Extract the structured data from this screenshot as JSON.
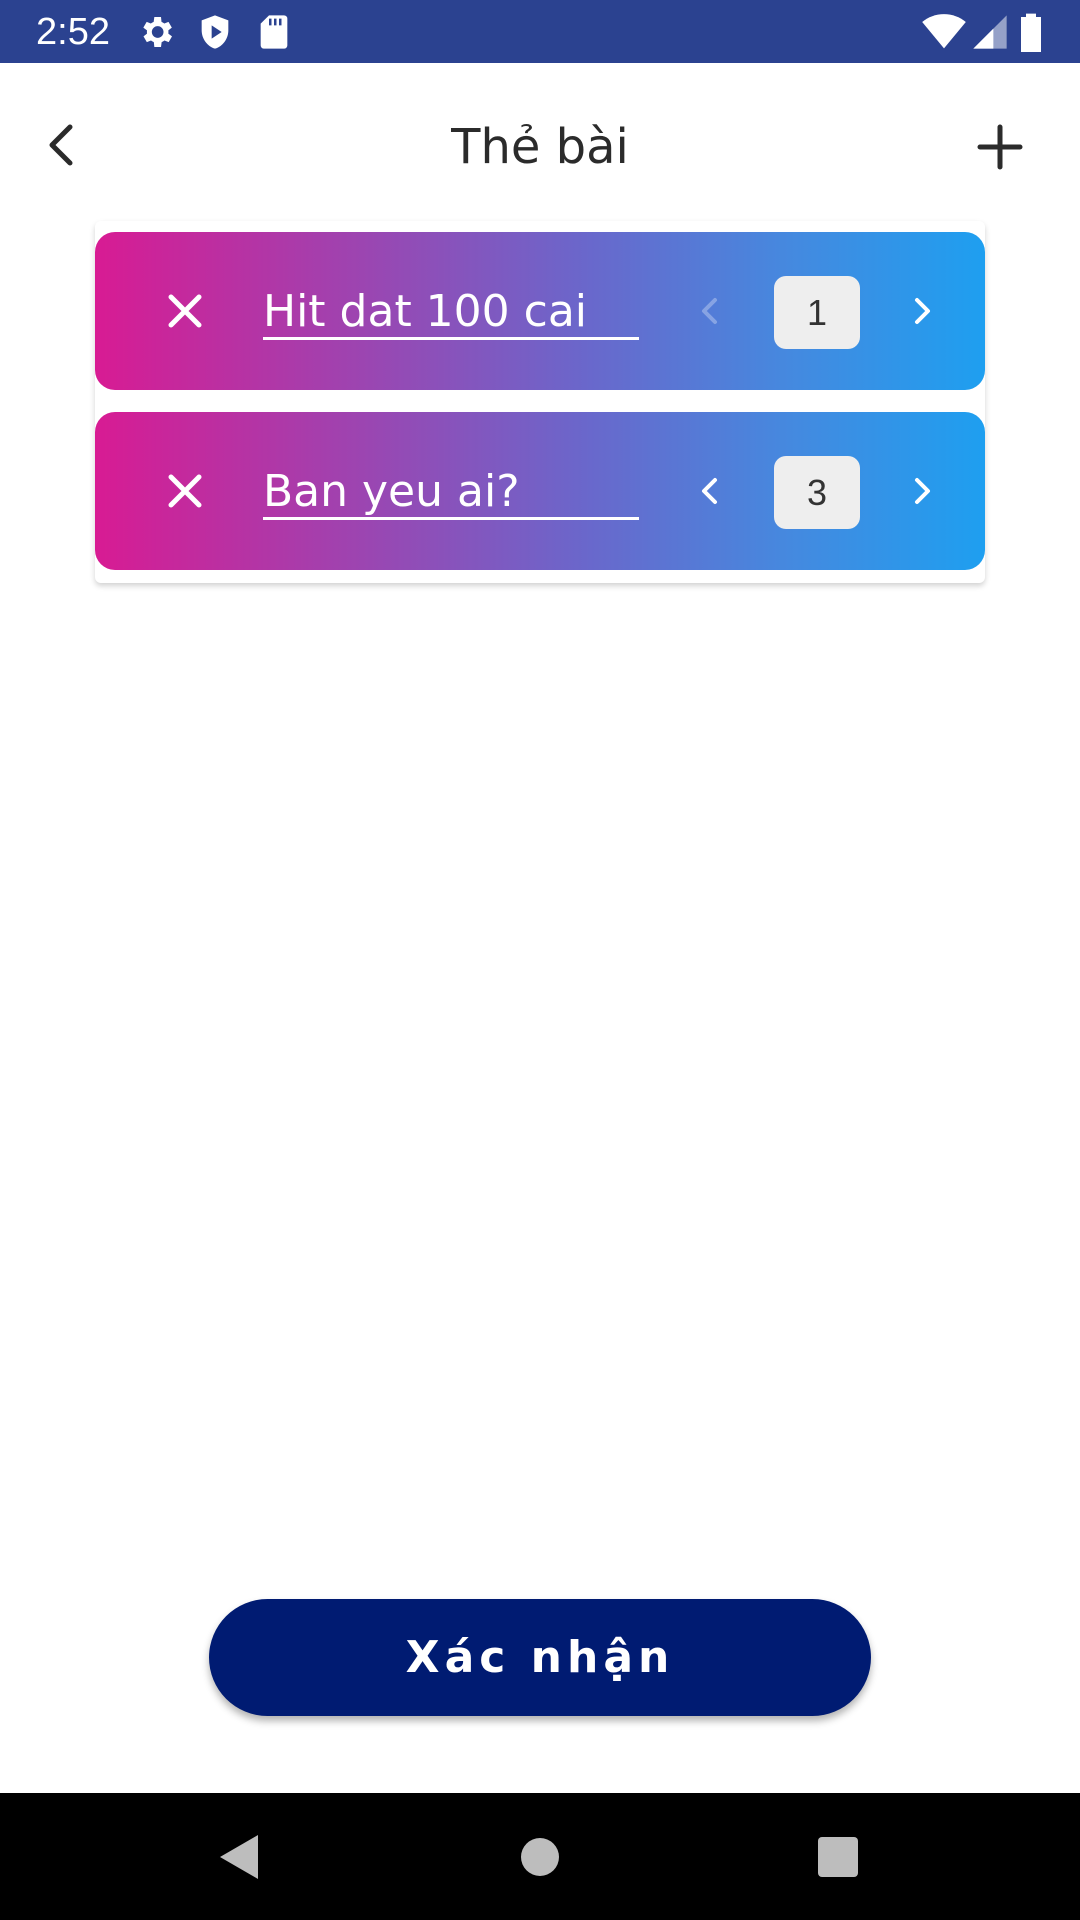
{
  "status_bar": {
    "time": "2:52",
    "icons": [
      "gear-icon",
      "shield-play-icon",
      "sd-card-icon",
      "wifi-icon",
      "signal-icon",
      "battery-icon"
    ]
  },
  "header": {
    "title": "Thẻ bài",
    "back_icon": "chevron-left-icon",
    "add_icon": "plus-icon"
  },
  "cards": [
    {
      "name": "Hit dat 100 cai",
      "count": "1",
      "prev_enabled": false
    },
    {
      "name": "Ban yeu ai?",
      "count": "3",
      "prev_enabled": true
    }
  ],
  "confirm": {
    "label": "Xác nhận"
  },
  "nav_bar": {
    "icons": [
      "back-triangle-icon",
      "home-circle-icon",
      "recents-square-icon"
    ]
  },
  "colors": {
    "status_bar": "#2b4290",
    "card_gradient_start": "#d81b93",
    "card_gradient_end": "#1e9ff0",
    "confirm_button": "#001b72"
  }
}
